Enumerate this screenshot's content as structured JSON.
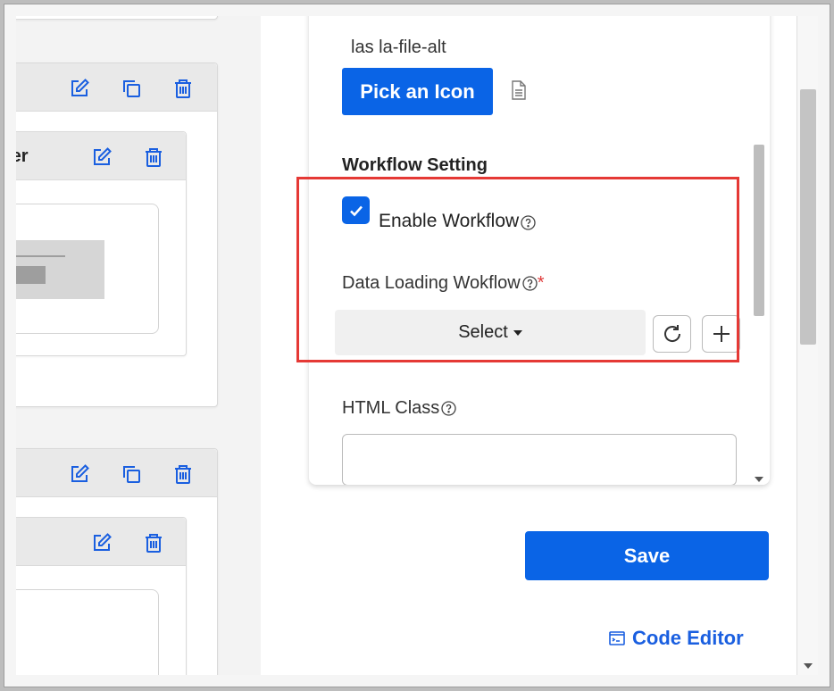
{
  "canvas": {
    "card_title_partial": "ter"
  },
  "panel": {
    "icon_class_value": "las la-file-alt",
    "pick_icon_label": "Pick an Icon",
    "workflow_heading": "Workflow Setting",
    "enable_workflow_label": "Enable Workflow",
    "enable_workflow_checked": true,
    "data_loading_label": "Data Loading Wokflow",
    "required_marker": "*",
    "select_label": "Select",
    "html_class_label": "HTML Class",
    "html_class_value": ""
  },
  "actions": {
    "save_label": "Save",
    "code_editor_label": "Code Editor"
  },
  "icons": {
    "edit": "edit-icon",
    "copy": "copy-icon",
    "delete": "trash-icon",
    "file": "file-icon",
    "help": "help-circle-icon",
    "refresh": "refresh-icon",
    "add": "plus-icon",
    "terminal": "terminal-icon"
  },
  "colors": {
    "primary": "#0a64e6",
    "highlight": "#e53935",
    "required": "#e03a3a"
  }
}
